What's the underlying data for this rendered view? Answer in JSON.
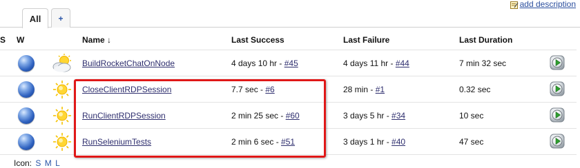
{
  "header": {
    "add_description": "add description"
  },
  "tabs": [
    {
      "label": "All",
      "active": true
    },
    {
      "label": "+",
      "active": false
    }
  ],
  "columns": {
    "s": "S",
    "w": "W",
    "name": "Name ↓",
    "last_success": "Last Success",
    "last_failure": "Last Failure",
    "last_duration": "Last Duration"
  },
  "jobs": [
    {
      "name": "BuildRocketChatOnNode",
      "status": "blue",
      "weather": "partly-cloudy",
      "last_success_time": "4 days 10 hr - ",
      "last_success_build": "#45",
      "last_failure_time": "4 days 11 hr - ",
      "last_failure_build": "#44",
      "last_duration": "7 min 32 sec"
    },
    {
      "name": "CloseClientRDPSession",
      "status": "blue",
      "weather": "sunny",
      "last_success_time": "7.7 sec - ",
      "last_success_build": "#6",
      "last_failure_time": "28 min - ",
      "last_failure_build": "#1",
      "last_duration": "0.32 sec"
    },
    {
      "name": "RunClientRDPSession",
      "status": "blue",
      "weather": "sunny",
      "last_success_time": "2 min 25 sec - ",
      "last_success_build": "#60",
      "last_failure_time": "3 days 5 hr - ",
      "last_failure_build": "#34",
      "last_duration": "10 sec"
    },
    {
      "name": "RunSeleniumTests",
      "status": "blue",
      "weather": "sunny",
      "last_success_time": "2 min 6 sec - ",
      "last_success_build": "#51",
      "last_failure_time": "3 days 1 hr - ",
      "last_failure_build": "#40",
      "last_duration": "47 sec"
    }
  ],
  "legend": {
    "label": "Icon:",
    "sizes": [
      "S",
      "M",
      "L"
    ]
  },
  "colors": {
    "highlight": "#e01818",
    "link": "#2e2e6e",
    "status_blue": "#2f62c0"
  }
}
